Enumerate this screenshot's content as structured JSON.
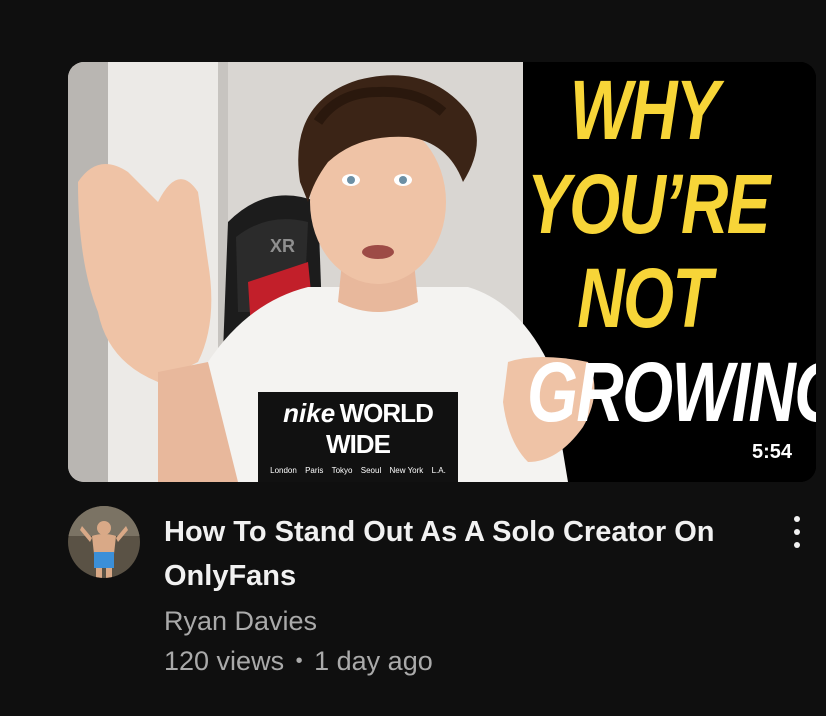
{
  "video": {
    "thumbnail": {
      "headline": [
        "WHY",
        "YOU’RE",
        "NOT",
        "GROWING"
      ],
      "shirt_brand": "nike",
      "shirt_text": "WORLD WIDE",
      "shirt_cities": [
        "London",
        "Paris",
        "Tokyo",
        "Seoul",
        "New York",
        "L.A."
      ],
      "chair_mark": "XR",
      "duration": "5:54"
    },
    "title": "How To Stand Out As A Solo Creator On OnlyFans",
    "channel": "Ryan Davies",
    "views": "120 views",
    "separator": "•",
    "age": "1 day ago"
  },
  "icons": {
    "menu": "more-vert-icon"
  },
  "colors": {
    "background": "#0f0f0f",
    "title": "#f1f1f1",
    "secondary_text": "#aaaaaa",
    "headline_yellow": "#f7d538"
  }
}
